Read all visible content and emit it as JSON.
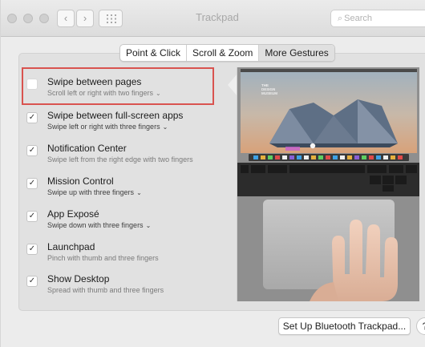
{
  "window": {
    "title": "Trackpad"
  },
  "search": {
    "placeholder": "Search"
  },
  "tabs": [
    {
      "label": "Point & Click",
      "active": false
    },
    {
      "label": "Scroll & Zoom",
      "active": false
    },
    {
      "label": "More Gestures",
      "active": true
    }
  ],
  "gestures": [
    {
      "title": "Swipe between pages",
      "description": "Scroll left or right with two fingers",
      "checked": false,
      "has_menu": true
    },
    {
      "title": "Swipe between full-screen apps",
      "description": "Swipe left or right with three fingers",
      "checked": true,
      "has_menu": true
    },
    {
      "title": "Notification Center",
      "description": "Swipe left from the right edge with two fingers",
      "checked": true,
      "has_menu": false
    },
    {
      "title": "Mission Control",
      "description": "Swipe up with three fingers",
      "checked": true,
      "has_menu": true
    },
    {
      "title": "App Exposé",
      "description": "Swipe down with three fingers",
      "checked": true,
      "has_menu": true
    },
    {
      "title": "Launchpad",
      "description": "Pinch with thumb and three fingers",
      "checked": true,
      "has_menu": false
    },
    {
      "title": "Show Desktop",
      "description": "Spread with thumb and three fingers",
      "checked": true,
      "has_menu": false
    }
  ],
  "preview": {
    "website_logo": "THE DESIGN MUSEUM"
  },
  "buttons": {
    "setup_bluetooth": "Set Up Bluetooth Trackpad...",
    "help": "?"
  },
  "colors": {
    "highlight": "#d9534f",
    "window_bg": "#ececec",
    "panel_bg": "#e1e1e1"
  }
}
